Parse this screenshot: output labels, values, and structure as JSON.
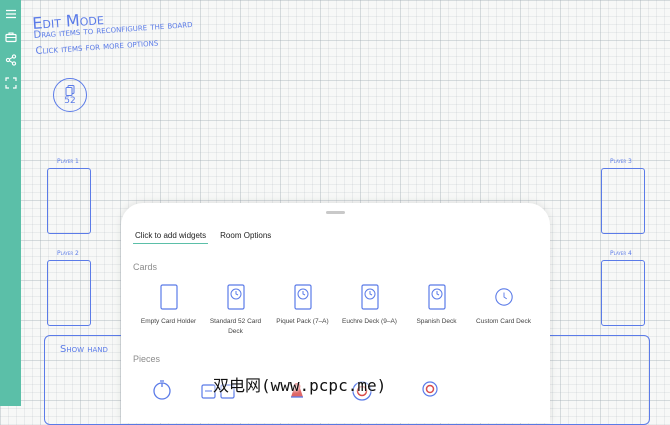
{
  "sidebar": {
    "icons": [
      "menu-icon",
      "briefcase-icon",
      "share-icon",
      "fullscreen-icon"
    ]
  },
  "board": {
    "title": "Edit Mode",
    "instructions": [
      "Drag items to reconfigure the board",
      "Click items for more options"
    ],
    "deck_count": "52",
    "players": [
      "Player 1",
      "Player 2",
      "Player 3",
      "Player 4"
    ],
    "show_hand": "Show hand"
  },
  "panel": {
    "tabs": [
      "Click to add widgets",
      "Room Options"
    ],
    "sections": {
      "cards": "Cards",
      "pieces": "Pieces"
    },
    "card_widgets": [
      {
        "label": "Empty Card Holder",
        "icon": "empty-card-icon"
      },
      {
        "label": "Standard 52 Card Deck",
        "icon": "deck-icon"
      },
      {
        "label": "Piquet Pack (7–A)",
        "icon": "deck-icon"
      },
      {
        "label": "Euchre Deck (9–A)",
        "icon": "deck-icon"
      },
      {
        "label": "Spanish Deck",
        "icon": "deck-icon"
      },
      {
        "label": "Custom Card Deck",
        "icon": "custom-deck-icon"
      }
    ]
  },
  "watermark": "双电网(www.pcpc.me)",
  "colors": {
    "accent": "#5bbfa8",
    "ink": "#5b7be8"
  }
}
